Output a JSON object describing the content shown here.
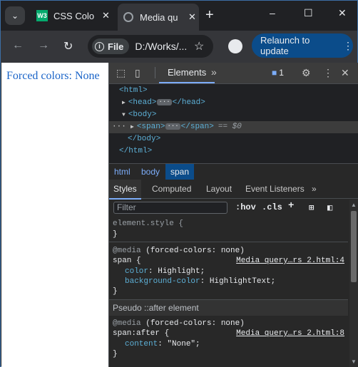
{
  "tabs": [
    {
      "favicon": "W3",
      "title": "CSS Colo",
      "close": "✕"
    },
    {
      "title": "Media qu",
      "close": "✕"
    }
  ],
  "window_controls": {
    "minimize": "–",
    "maximize": "☐",
    "close": "✕"
  },
  "toolbar": {
    "back": "←",
    "forward": "→",
    "reload": "↻",
    "info_label": "File",
    "url": "D:/Works/...",
    "relaunch_label": "Relaunch to update",
    "relaunch_menu": "⋮"
  },
  "page": {
    "text": "Forced colors: None"
  },
  "devtools": {
    "main_tab": "Elements",
    "more_tabs": "»",
    "issues_count": "1",
    "dom": {
      "html_open": "<html>",
      "head": "<head>",
      "head_close": "</head>",
      "body_open": "<body>",
      "span_open": "<span>",
      "span_close": "</span>",
      "span_eq": "== $0",
      "body_close": "</body>",
      "html_close": "</html>",
      "ellipsis": "···",
      "row_dots": "···"
    },
    "breadcrumbs": [
      "html",
      "body",
      "span"
    ],
    "subtabs": [
      "Styles",
      "Computed",
      "Layout",
      "Event Listeners",
      "»"
    ],
    "filter_placeholder": "Filter",
    "hov": ":hov",
    ".cls": ".cls",
    "styles": {
      "element_style": "element.style {",
      "close_brace": "}",
      "rule1_media_kw": "@media",
      "rule1_media_query": "(forced-colors: none)",
      "rule1_selector": "span {",
      "rule1_link": "Media query…rs 2.html:4",
      "rule1_prop1": "color",
      "rule1_val1": "Highlight;",
      "rule1_prop2": "background-color",
      "rule1_val2": "HighlightText;",
      "pseudo_header": "Pseudo ::after element",
      "rule2_media_kw": "@media",
      "rule2_media_query": "(forced-colors: none)",
      "rule2_selector": "span:after {",
      "rule2_link": "Media query…rs 2.html:8",
      "rule2_prop1": "content",
      "rule2_val1": "\"None\";"
    }
  },
  "colors": {
    "accent": "#7cacf8",
    "page_text": "#1a64c8",
    "relaunch_bg": "#0b4c8a"
  }
}
